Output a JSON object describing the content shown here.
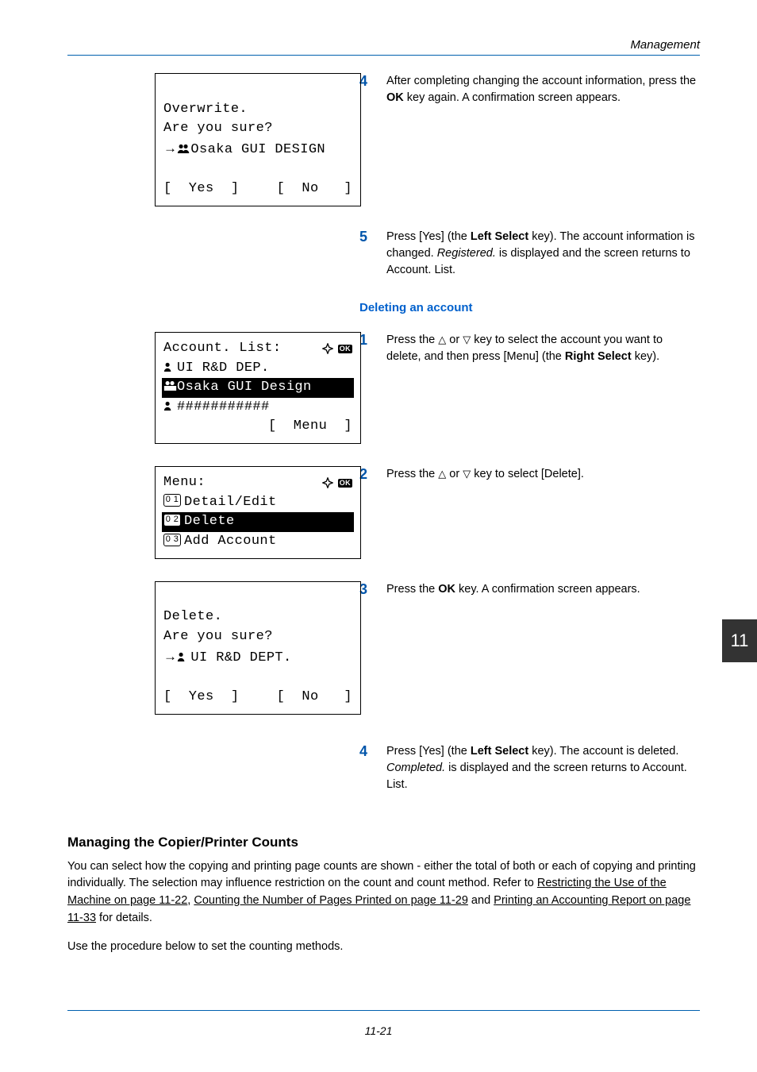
{
  "header": {
    "section": "Management"
  },
  "lcd1": {
    "line1": "Overwrite.",
    "line2": "Are you sure?",
    "line3": "Osaka GUI DESIGN",
    "yes": "[  Yes  ]",
    "no": "[  No   ]"
  },
  "step4_text": "After completing changing the account information, press the ",
  "step4_bold": "OK",
  "step4_text2": " key again. A confirmation screen appears.",
  "step5_t1": "Press [Yes] (the ",
  "step5_b1": "Left Select",
  "step5_t2": " key). The account information is changed. ",
  "step5_i1": "Registered.",
  "step5_t3": " is displayed and the screen returns to Account. List.",
  "subheading": "Deleting an account",
  "lcd2": {
    "title": "Account. List:",
    "row1": "UI R&D DEP.",
    "row2": "Osaka GUI Design",
    "row3": "###########",
    "menu": "[  Menu  ]"
  },
  "lcd3": {
    "title": "Menu:",
    "opt1": "Detail/Edit",
    "opt2": "Delete",
    "opt3": "Add Account"
  },
  "lcd4": {
    "line1": "Delete.",
    "line2": "Are you sure?",
    "line3": "UI R&D DEPT.",
    "yes": "[  Yes  ]",
    "no": "[  No   ]"
  },
  "d_step1_a": "Press the ",
  "d_step1_b": " or ",
  "d_step1_c": " key to select the account you want to delete, and then press [Menu] (the ",
  "d_step1_bold": "Right Select",
  "d_step1_d": " key).",
  "d_step2_a": "Press the ",
  "d_step2_b": " or ",
  "d_step2_c": " key to select [Delete].",
  "d_step3_a": "Press the ",
  "d_step3_bold": "OK",
  "d_step3_b": " key. A confirmation screen appears.",
  "d_step4_a": "Press [Yes] (the ",
  "d_step4_bold": "Left Select",
  "d_step4_b": " key). The account is deleted. ",
  "d_step4_i": "Completed.",
  "d_step4_c": " is displayed and the screen returns to Account. List.",
  "section_heading": "Managing the Copier/Printer Counts",
  "para1_a": "You can select how the copying and printing page counts are shown - either the total of both or each of copying and printing individually. The selection may influence restriction on the count and count method. Refer to ",
  "link1": "Restricting the Use of the Machine on page 11-22",
  "para1_b": ", ",
  "link2": "Counting the Number of Pages Printed on page 11-29",
  "para1_c": " and ",
  "link3": "Printing an Accounting Report on page 11-33",
  "para1_d": " for details.",
  "para2": "Use the procedure below to set the counting methods.",
  "chapter": "11",
  "pagefoot": "11-21"
}
